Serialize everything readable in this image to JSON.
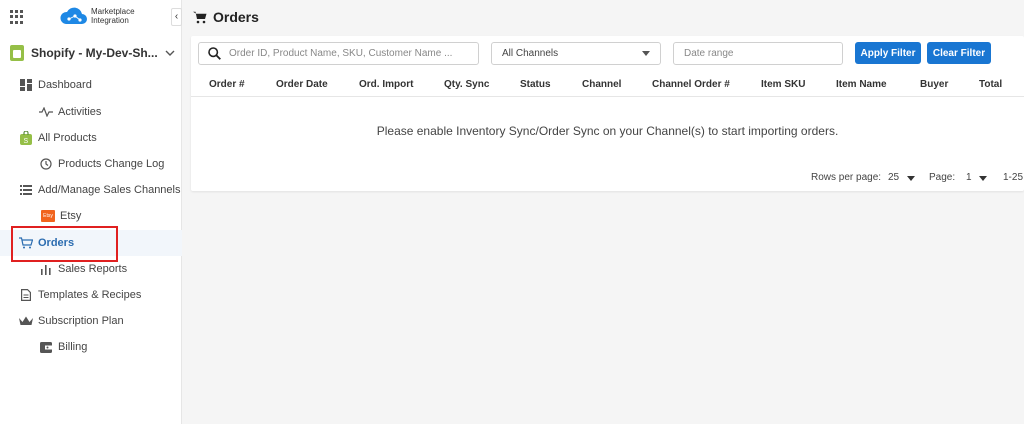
{
  "brand": {
    "logo_text_line1": "Marketplace",
    "logo_text_line2": "Integration",
    "collapse_glyph": "‹"
  },
  "store": {
    "name": "Shopify - My-Dev-Sh...",
    "chevron": "⌄"
  },
  "sidebar": {
    "items": [
      {
        "label": "Dashboard",
        "icon": "dashboard-icon"
      },
      {
        "label": "Activities",
        "icon": "activity-icon"
      },
      {
        "label": "All Products",
        "icon": "shopify-bag-icon"
      },
      {
        "label": "Products Change Log",
        "icon": "history-icon"
      },
      {
        "label": "Add/Manage Sales Channels",
        "icon": "list-icon"
      },
      {
        "label": "Etsy",
        "icon": "etsy-icon",
        "badge": "Etsy"
      },
      {
        "label": "Orders",
        "icon": "cart-icon"
      },
      {
        "label": "Sales Reports",
        "icon": "bar-chart-icon"
      },
      {
        "label": "Templates & Recipes",
        "icon": "document-icon"
      },
      {
        "label": "Subscription Plan",
        "icon": "crown-icon"
      },
      {
        "label": "Billing",
        "icon": "wallet-icon"
      }
    ]
  },
  "header": {
    "title": "Orders"
  },
  "filters": {
    "search_placeholder": "Order ID, Product Name, SKU, Customer Name ...",
    "channel_selected": "All Channels",
    "date_placeholder": "Date range",
    "apply_label": "Apply Filter",
    "clear_label": "Clear Filter"
  },
  "table": {
    "columns": [
      "Order #",
      "Order Date",
      "Ord. Import",
      "Qty. Sync",
      "Status",
      "Channel",
      "Channel Order #",
      "Item SKU",
      "Item Name",
      "Buyer",
      "Total"
    ],
    "empty_message": "Please enable Inventory Sync/Order Sync on your Channel(s) to start importing orders."
  },
  "pagination": {
    "rows_per_page_label": "Rows per page:",
    "rows_per_page_value": "25",
    "page_label": "Page:",
    "page_value": "1",
    "range_text": "1-25"
  },
  "colors": {
    "accent": "#1976d2",
    "highlight": "#e02020",
    "active_text": "#2b6cb0"
  }
}
